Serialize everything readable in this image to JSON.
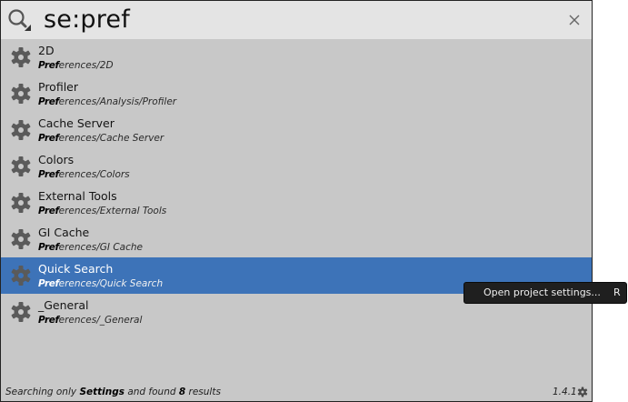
{
  "search": {
    "query": "se:pref"
  },
  "icons": {
    "search": "search-icon",
    "clear": "close-icon",
    "item": "gear-icon",
    "settings": "gear-icon"
  },
  "results": [
    {
      "title": "2D",
      "path_match": "Pref",
      "path_rest": "erences/2D",
      "selected": false
    },
    {
      "title": "Profiler",
      "path_match": "Pref",
      "path_rest": "erences/Analysis/Profiler",
      "selected": false
    },
    {
      "title": "Cache Server",
      "path_match": "Pref",
      "path_rest": "erences/Cache Server",
      "selected": false
    },
    {
      "title": "Colors",
      "path_match": "Pref",
      "path_rest": "erences/Colors",
      "selected": false
    },
    {
      "title": "External Tools",
      "path_match": "Pref",
      "path_rest": "erences/External Tools",
      "selected": false
    },
    {
      "title": "GI Cache",
      "path_match": "Pref",
      "path_rest": "erences/GI Cache",
      "selected": false
    },
    {
      "title": "Quick Search",
      "path_match": "Pref",
      "path_rest": "erences/Quick Search",
      "selected": true
    },
    {
      "title": "_General",
      "path_match": "Pref",
      "path_rest": "erences/_General",
      "selected": false
    }
  ],
  "status": {
    "prefix": "Searching only ",
    "provider": "Settings",
    "middle": " and found ",
    "count": "8",
    "suffix": " results",
    "version": "1.4.1"
  },
  "context_menu": {
    "label": "Open project settings...",
    "shortcut": "R"
  },
  "colors": {
    "selected_row": "#3d73b8",
    "panel": "#c8c8c8",
    "search_bar": "#e4e4e4",
    "menu": "#1f1f1f"
  }
}
